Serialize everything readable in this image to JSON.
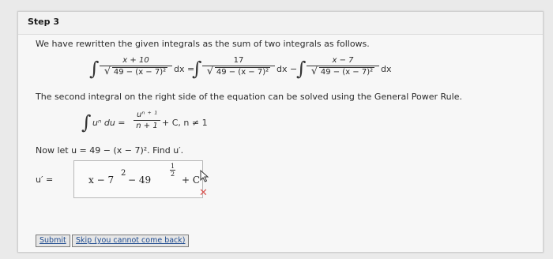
{
  "step": {
    "title": "Step 3"
  },
  "intro": "We have rewritten the given integrals as the sum of two integrals as follows.",
  "eq1": {
    "lhs_num": "x + 10",
    "lhs_den": "49 − (x − 7)²",
    "lhs_dx": "dx =",
    "mid_num": "17",
    "mid_den": "49 − (x − 7)²",
    "mid_dx": "dx −",
    "rhs_num": "x − 7",
    "rhs_den": "49 − (x − 7)²",
    "rhs_dx": "dx"
  },
  "second_text": "The second integral on the right side of the equation can be solved using the General Power Rule.",
  "power_rule": {
    "integrand": "uⁿ du =",
    "num": "uⁿ ⁺ ¹",
    "den": "n + 1",
    "tail": "+ C, n ≠ 1"
  },
  "let_text": "Now let u = 49 − (x − 7)². Find u′.",
  "answer": {
    "label": "u′ =",
    "expr_main": "x − 7",
    "exp2": "2",
    "minus49": "− 49",
    "half_num": "1",
    "half_den": "2",
    "plusC": "+ C"
  },
  "buttons": {
    "submit": "Submit",
    "skip": "Skip (you cannot come back)"
  },
  "colors": {
    "error": "#d9534f"
  }
}
